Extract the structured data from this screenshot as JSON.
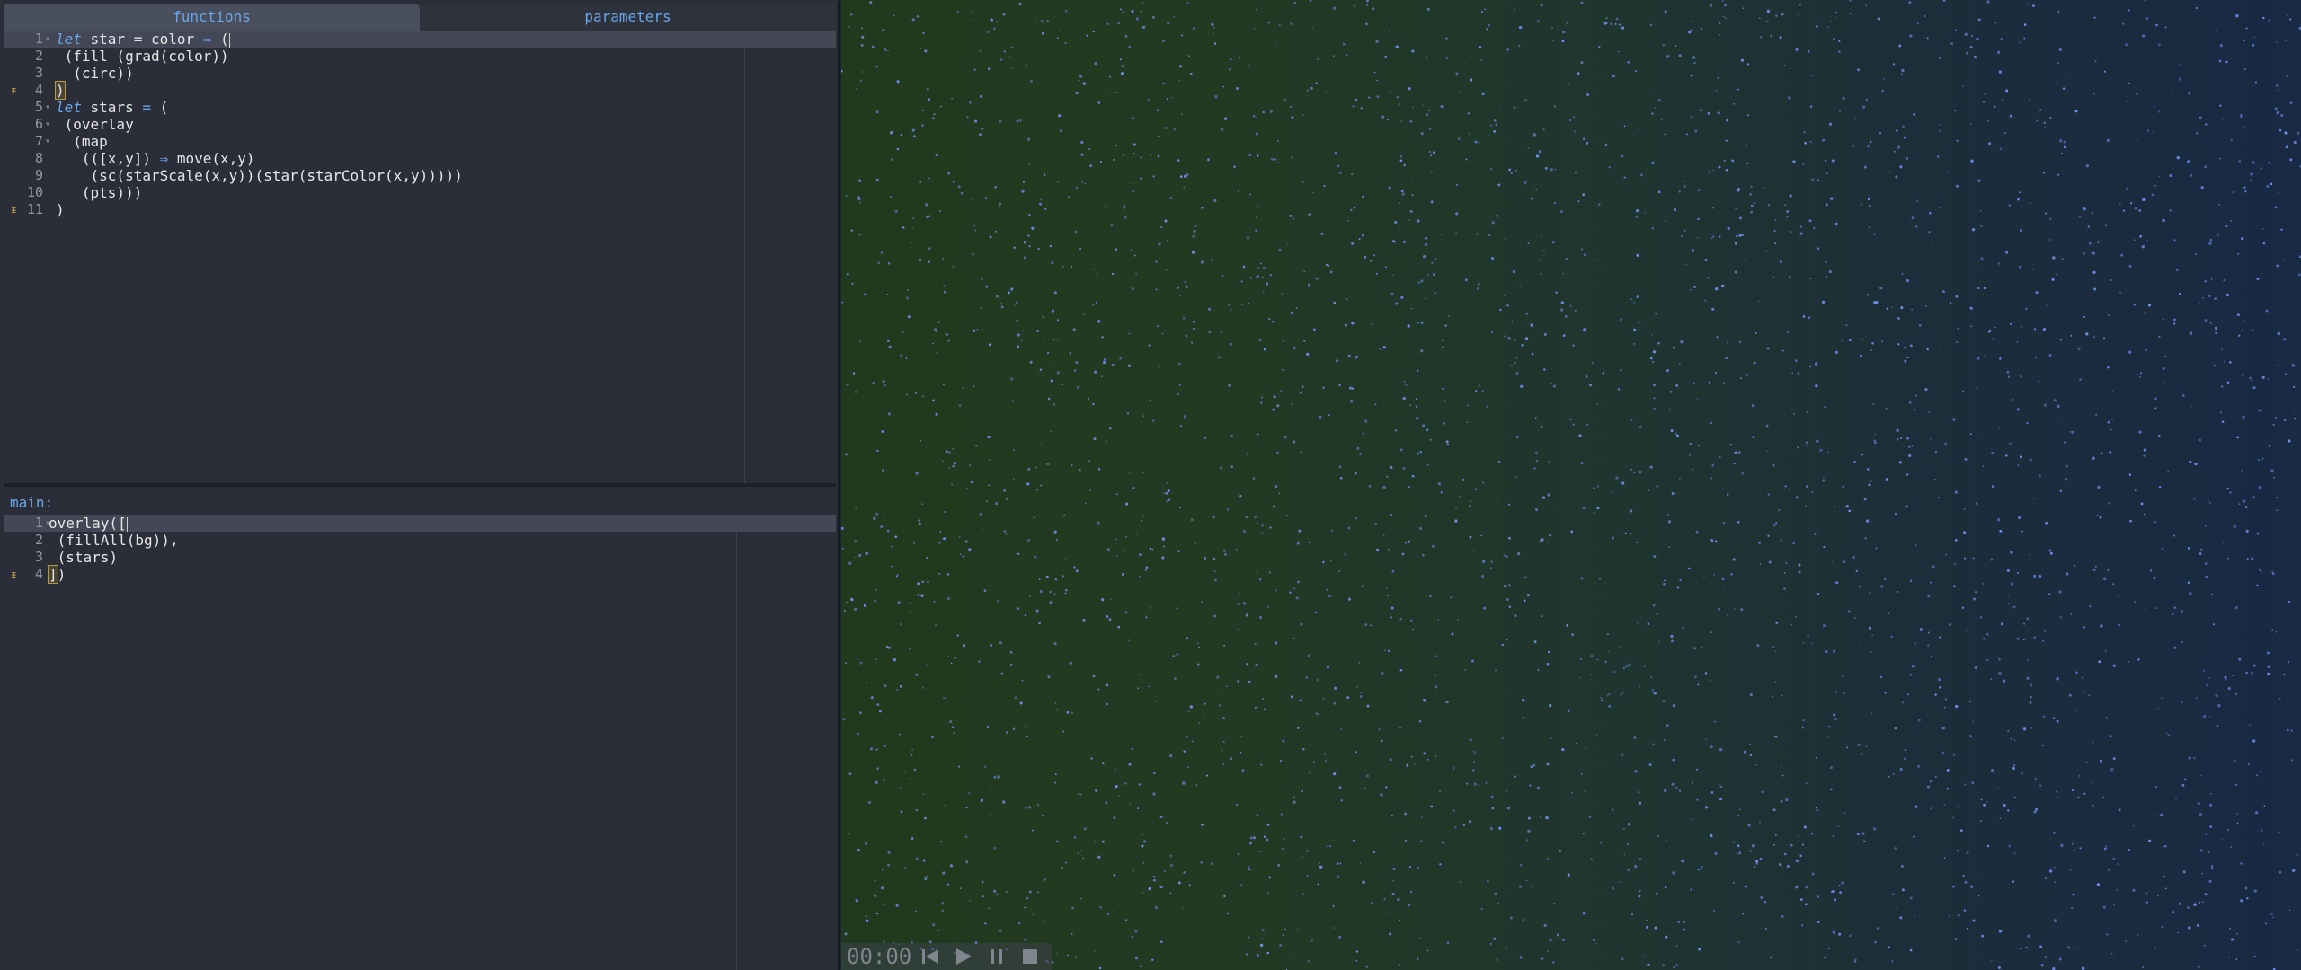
{
  "tabs": [
    {
      "label": "functions",
      "active": true
    },
    {
      "label": "parameters",
      "active": false
    }
  ],
  "functions_editor": {
    "lines": [
      {
        "num": "1",
        "fold": "",
        "arrow": "▾",
        "parts": [
          [
            "kw",
            "let"
          ],
          [
            "t",
            " star = color "
          ],
          [
            "op",
            "⇒"
          ],
          [
            "t",
            " ("
          ]
        ],
        "active": true,
        "cursor": true
      },
      {
        "num": "2",
        "fold": "",
        "arrow": "",
        "parts": [
          [
            "t",
            " (fill (grad(color))"
          ]
        ]
      },
      {
        "num": "3",
        "fold": "",
        "arrow": "",
        "parts": [
          [
            "t",
            "  (circ))"
          ]
        ]
      },
      {
        "num": "4",
        "fold": "⬍",
        "arrow": "",
        "parts": [
          [
            "br",
            ")"
          ]
        ]
      },
      {
        "num": "5",
        "fold": "",
        "arrow": "▾",
        "parts": [
          [
            "kw",
            "let"
          ],
          [
            "t",
            " stars "
          ],
          [
            "op",
            "="
          ],
          [
            "t",
            " ("
          ]
        ]
      },
      {
        "num": "6",
        "fold": "",
        "arrow": "▾",
        "parts": [
          [
            "t",
            " (overlay"
          ]
        ]
      },
      {
        "num": "7",
        "fold": "",
        "arrow": "▾",
        "parts": [
          [
            "t",
            "  (map"
          ]
        ]
      },
      {
        "num": "8",
        "fold": "",
        "arrow": "",
        "parts": [
          [
            "t",
            "   (([x,y]) "
          ],
          [
            "op",
            "⇒"
          ],
          [
            "t",
            " move(x,y)"
          ]
        ]
      },
      {
        "num": "9",
        "fold": "",
        "arrow": "",
        "parts": [
          [
            "t",
            "    (sc(starScale(x,y))(star(starColor(x,y)))))"
          ]
        ]
      },
      {
        "num": "10",
        "fold": "",
        "arrow": "",
        "parts": [
          [
            "t",
            "   (pts)))"
          ]
        ]
      },
      {
        "num": "11",
        "fold": "⬍",
        "arrow": "",
        "parts": [
          [
            "t",
            ")"
          ]
        ]
      }
    ]
  },
  "main_label": "main:",
  "main_editor": {
    "lines": [
      {
        "num": "1",
        "fold": "",
        "arrow": "▾",
        "parts": [
          [
            "t",
            "overlay(["
          ]
        ],
        "active": true,
        "cursor": true
      },
      {
        "num": "2",
        "fold": "",
        "arrow": "",
        "parts": [
          [
            "t",
            " (fillAll(bg)),"
          ]
        ]
      },
      {
        "num": "3",
        "fold": "",
        "arrow": "",
        "parts": [
          [
            "t",
            " (stars)"
          ]
        ]
      },
      {
        "num": "4",
        "fold": "⬍",
        "arrow": "",
        "parts": [
          [
            "br",
            "]"
          ],
          [
            "t",
            ")"
          ]
        ]
      }
    ]
  },
  "transport": {
    "time": "00:00"
  },
  "colors": {
    "accent": "#6aa6e8",
    "star": "#6f8ff0",
    "bg_left": "#213a1d",
    "bg_right": "#182a44"
  },
  "icons": [
    "skip-back-icon",
    "play-icon",
    "pause-icon",
    "stop-icon"
  ]
}
